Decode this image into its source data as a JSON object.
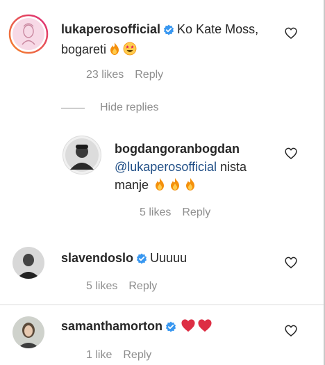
{
  "comments": [
    {
      "username": "lukaperosofficial",
      "verified": true,
      "text": "Ko Kate Moss, bogareti",
      "emojis": [
        "fire",
        "star-struck"
      ],
      "likes": "23 likes",
      "reply": "Reply"
    },
    {
      "username": "bogdangoranbogdan",
      "verified": false,
      "mention": "@lukaperosofficial",
      "text": "nista manje",
      "emojis": [
        "fire",
        "fire",
        "fire"
      ],
      "likes": "5 likes",
      "reply": "Reply"
    },
    {
      "username": "slavendoslo",
      "verified": true,
      "text": "Uuuuu",
      "likes": "5 likes",
      "reply": "Reply"
    },
    {
      "username": "samanthamorton",
      "verified": true,
      "text": "",
      "emojis": [
        "red-heart",
        "red-heart"
      ],
      "likes": "1 like",
      "reply": "Reply"
    }
  ],
  "hide_replies": "Hide replies",
  "colors": {
    "verified": "#3897f0",
    "mention": "#1f4e86",
    "meta": "#8e8e8e",
    "story_ring_start": "#f58529",
    "story_ring_end": "#dd2a7b"
  }
}
